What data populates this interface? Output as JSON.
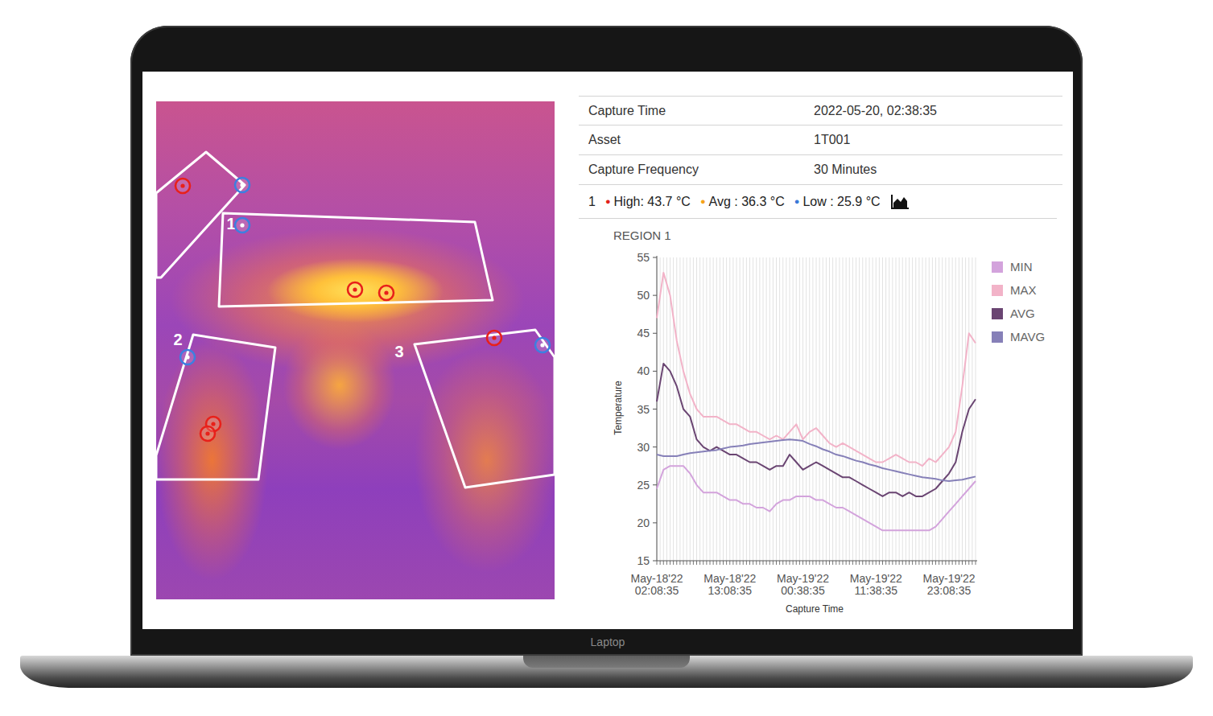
{
  "device": {
    "label": "Laptop"
  },
  "thermal_image": {
    "regions": [
      {
        "markers": [
          {
            "kind": "high"
          },
          {
            "kind": "low"
          }
        ]
      },
      {
        "label": "1",
        "markers": [
          {
            "kind": "low"
          },
          {
            "kind": "high"
          },
          {
            "kind": "high"
          }
        ]
      },
      {
        "label": "2",
        "markers": [
          {
            "kind": "low"
          },
          {
            "kind": "high"
          },
          {
            "kind": "high"
          }
        ]
      },
      {
        "label": "3",
        "markers": [
          {
            "kind": "high"
          },
          {
            "kind": "low"
          }
        ]
      }
    ]
  },
  "details": [
    {
      "label": "Capture Time",
      "value": "2022-05-20, 02:38:35"
    },
    {
      "label": "Asset",
      "value": "1T001"
    },
    {
      "label": "Capture Frequency",
      "value": "30 Minutes"
    }
  ],
  "stats": {
    "region": "1",
    "items": [
      {
        "dot": "●",
        "text": "High: 43.7 °C",
        "color": "#e2231a"
      },
      {
        "dot": "●",
        "text": "Avg : 36.3 °C",
        "color": "#f5a31a"
      },
      {
        "dot": "●",
        "text": "Low : 25.9 °C",
        "color": "#3b78d8"
      }
    ]
  },
  "chart": {
    "title": "REGION 1",
    "y_axis": {
      "label": "Temperature",
      "ticks": [
        "55",
        "50",
        "45",
        "40",
        "35",
        "30",
        "25",
        "20",
        "15"
      ]
    },
    "x_axis": {
      "label": "Capture Time",
      "ticks": [
        {
          "date": "May-18'22",
          "time": "02:08:35"
        },
        {
          "date": "May-18'22",
          "time": "13:08:35"
        },
        {
          "date": "May-19'22",
          "time": "00:38:35"
        },
        {
          "date": "May-19'22",
          "time": "11:38:35"
        },
        {
          "date": "May-19'22",
          "time": "23:08:35"
        }
      ]
    },
    "series": [
      {
        "name": "MIN",
        "color": "#d3a3dc",
        "values": [
          24.5,
          27,
          27.5,
          27.5,
          27.5,
          26.5,
          25,
          24,
          24,
          24,
          23.5,
          23,
          23,
          22.5,
          22.5,
          22,
          22,
          21.5,
          22.5,
          23,
          23,
          23.5,
          23.5,
          23.5,
          23,
          23,
          22.5,
          22,
          22,
          21.5,
          21,
          20.5,
          20,
          19.5,
          19,
          19,
          19,
          19,
          19,
          19,
          19,
          19,
          19.5,
          20.5,
          21.5,
          22.5,
          23.5,
          24.5,
          25.5
        ]
      },
      {
        "name": "MAX",
        "color": "#f2b3c8",
        "values": [
          47,
          53,
          50,
          44,
          40,
          37,
          35,
          34,
          34,
          34,
          33.5,
          33,
          33,
          32.5,
          32,
          32,
          31.5,
          31,
          31.5,
          31,
          32,
          33,
          31,
          32,
          32.5,
          31.5,
          30.5,
          30,
          30.5,
          30,
          29.5,
          29,
          28.5,
          28,
          28,
          28.5,
          29,
          28.5,
          28,
          28,
          27.5,
          28.5,
          28,
          29,
          30,
          32,
          38,
          45,
          43.7
        ]
      },
      {
        "name": "AVG",
        "color": "#6a4572",
        "values": [
          36,
          41,
          40,
          38,
          35,
          34,
          31,
          30,
          29.5,
          30,
          29.5,
          29,
          29,
          28.5,
          28,
          28,
          27.5,
          27,
          27.5,
          27.5,
          29,
          28,
          27,
          27.5,
          28,
          27.5,
          27,
          26.5,
          26,
          26,
          25.5,
          25,
          24.5,
          24,
          23.5,
          24,
          24,
          23.5,
          24,
          23.5,
          23.5,
          24,
          24.5,
          25.5,
          26.5,
          28,
          32,
          35,
          36.3
        ]
      },
      {
        "name": "MAVG",
        "color": "#8680b8",
        "values": [
          29,
          28.8,
          28.8,
          28.8,
          29,
          29.2,
          29.3,
          29.4,
          29.5,
          29.6,
          29.8,
          30,
          30.1,
          30.2,
          30.4,
          30.5,
          30.6,
          30.7,
          30.8,
          30.9,
          31,
          30.9,
          30.8,
          30.4,
          30.1,
          29.7,
          29.4,
          29,
          28.8,
          28.5,
          28.2,
          28,
          27.7,
          27.5,
          27.2,
          27,
          26.8,
          26.6,
          26.4,
          26.2,
          26,
          25.9,
          25.8,
          25.6,
          25.5,
          25.6,
          25.7,
          25.9,
          26.1
        ]
      }
    ]
  }
}
